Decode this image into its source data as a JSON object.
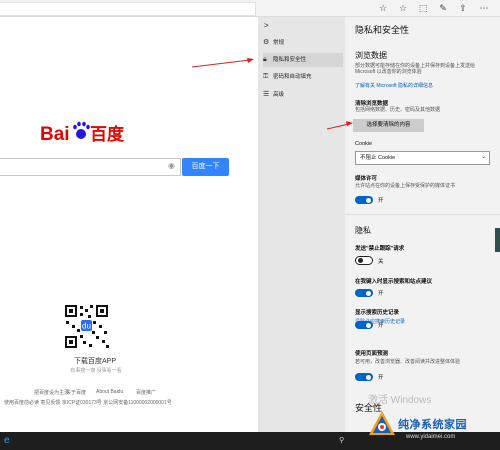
{
  "browser": {
    "toolbar_icons": [
      "reading-list-icon",
      "favorites-icon",
      "reading-icon",
      "pen-icon",
      "share-icon",
      "more-icon"
    ]
  },
  "baidu": {
    "logo_text": "Bai百度",
    "search_button": "百度一下",
    "app_title": "下载百度APP",
    "app_sub": "有事搜一搜 没事看一看",
    "footer_links": [
      "把百度设为主页",
      "关于百度",
      "About Baidu",
      "百度推广"
    ],
    "footer_line2": "使用百度前必读 意见反馈 京ICP证030173号 京公网安备11000002000001号"
  },
  "nav": {
    "expand_glyph": ">",
    "items": [
      {
        "label": "常规",
        "icon": "gear-icon"
      },
      {
        "label": "隐私和安全性",
        "icon": "lock-icon"
      },
      {
        "label": "密码和自动填充",
        "icon": "key-icon"
      },
      {
        "label": "高级",
        "icon": "sliders-icon"
      }
    ]
  },
  "panel": {
    "title": "隐私和安全性",
    "browsing_data": {
      "heading": "浏览数据",
      "desc": "部分数据可能存储在你的设备上并保存到设备上发送给 Microsoft 以改善你的浏览体验",
      "link": "了解有关 Microsoft 隐私的详细信息"
    },
    "clear": {
      "label": "清除浏览数据",
      "desc": "包括网络数据、历史、密码及其他数据",
      "button": "选择要清除的内容"
    },
    "cookie": {
      "label": "Cookie",
      "value": "不阻止 Cookie"
    },
    "media": {
      "label": "媒体许可",
      "desc": "允许站点在你的设备上保存受保护的媒体证书",
      "toggle_text": "开"
    },
    "privacy": {
      "heading": "隐私",
      "dnt_label": "发送\"禁止跟踪\"请求",
      "dnt_toggle": "关",
      "suggest_label": "在我键入时显示搜索和站点建议",
      "suggest_toggle": "开",
      "history_label": "显示搜索历史记录",
      "history_link": "清除必应搜索历史记录",
      "history_toggle": "开",
      "predict_label": "使用页面预测",
      "predict_desc": "若可用，改善浏览器、改善阅读并改进整体体验",
      "predict_toggle": "开"
    },
    "security_heading": "安全性",
    "watermark": "激活 Windows"
  },
  "overlay": {
    "site_title": "纯净系统家园",
    "site_url": "www.yidaimei.com"
  },
  "colors": {
    "accent": "#0064c8",
    "baidu_blue": "#3385ff",
    "baidu_red": "#e10602",
    "annotation_red": "#e02020"
  }
}
